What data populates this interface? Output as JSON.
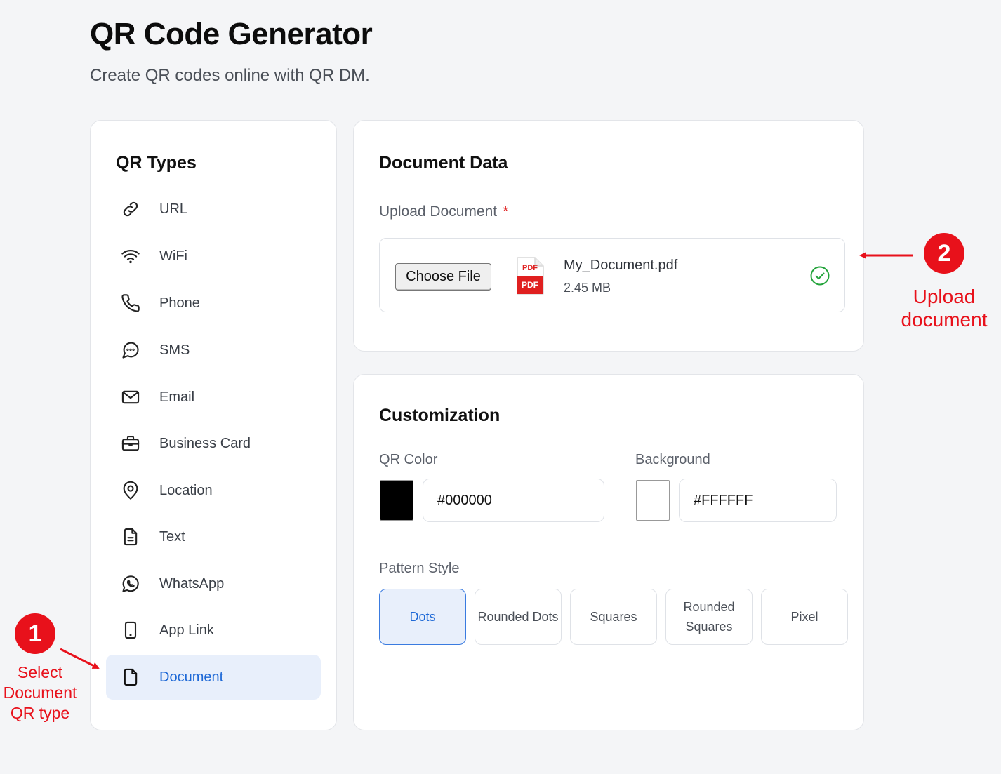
{
  "page": {
    "title": "QR Code Generator",
    "subtitle": "Create QR codes online with QR DM."
  },
  "sidebar": {
    "title": "QR Types",
    "items": [
      {
        "label": "URL",
        "icon": "link-icon"
      },
      {
        "label": "WiFi",
        "icon": "wifi-icon"
      },
      {
        "label": "Phone",
        "icon": "phone-icon"
      },
      {
        "label": "SMS",
        "icon": "message-icon"
      },
      {
        "label": "Email",
        "icon": "mail-icon"
      },
      {
        "label": "Business Card",
        "icon": "briefcase-icon"
      },
      {
        "label": "Location",
        "icon": "location-pin-icon"
      },
      {
        "label": "Text",
        "icon": "text-file-icon"
      },
      {
        "label": "WhatsApp",
        "icon": "whatsapp-icon"
      },
      {
        "label": "App Link",
        "icon": "smartphone-icon"
      },
      {
        "label": "Document",
        "icon": "document-icon",
        "active": true
      }
    ]
  },
  "document_data": {
    "title": "Document Data",
    "upload_label": "Upload Document",
    "required_mark": "*",
    "choose_button": "Choose File",
    "file_icon_text": "PDF",
    "file_name": "My_Document.pdf",
    "file_size": "2.45 MB"
  },
  "customization": {
    "title": "Customization",
    "qr_color_label": "QR Color",
    "qr_color_value": "#000000",
    "background_label": "Background",
    "background_value": "#FFFFFF",
    "pattern_label": "Pattern Style",
    "patterns": [
      {
        "label": "Dots",
        "active": true
      },
      {
        "label": "Rounded Dots"
      },
      {
        "label": "Squares"
      },
      {
        "label": "Rounded Squares"
      },
      {
        "label": "Pixel"
      }
    ]
  },
  "annotations": {
    "step1_number": "1",
    "step1_text": "Select Document QR type",
    "step2_number": "2",
    "step2_text": "Upload document"
  },
  "colors": {
    "accent": "#1d68d6",
    "active_bg": "#e8effb",
    "annotation_red": "#e8111b",
    "success_green": "#22a33a",
    "pdf_red": "#e02020"
  }
}
